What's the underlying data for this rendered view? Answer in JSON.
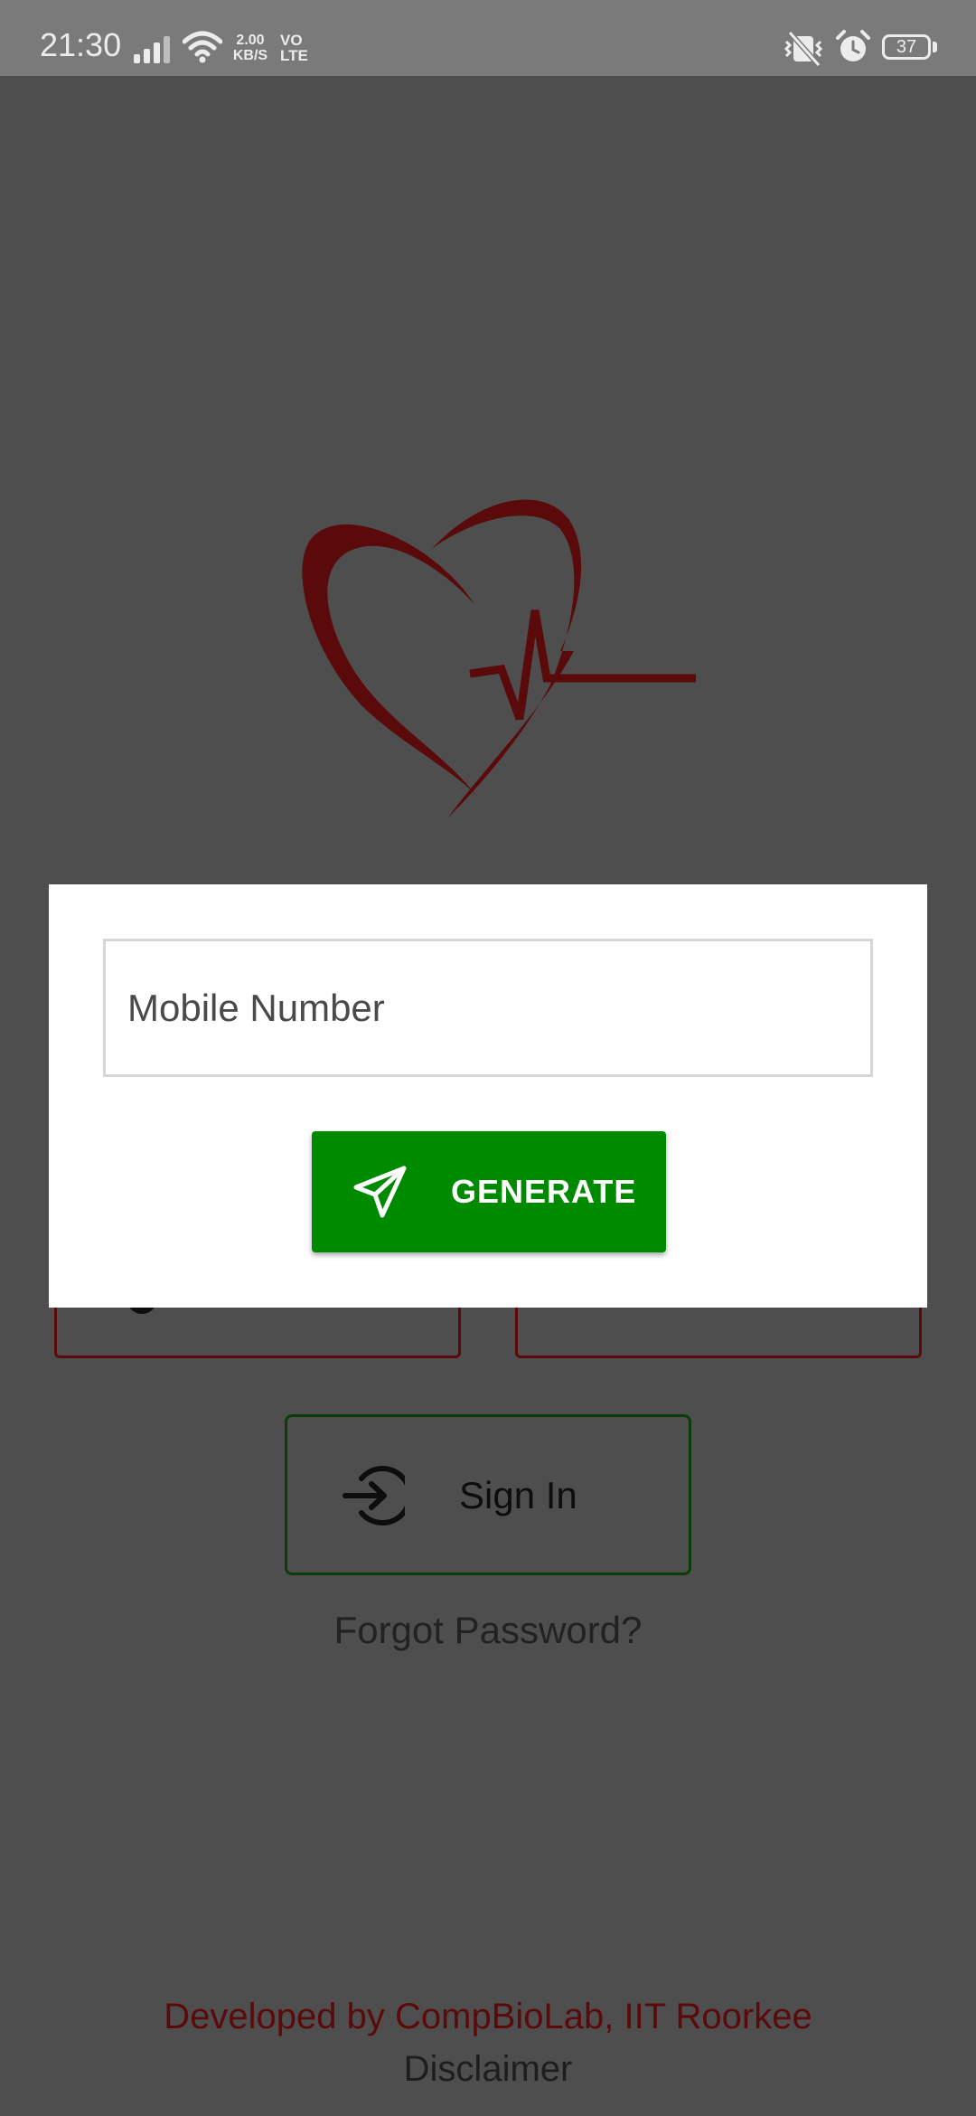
{
  "status_bar": {
    "time": "21:30",
    "net_speed_value": "2.00",
    "net_speed_unit": "KB/S",
    "net_type_top": "VO",
    "net_type_bottom": "LTE",
    "battery_level": "37",
    "icons": [
      "signal-icon",
      "wifi-icon",
      "vibrate-off-icon",
      "alarm-icon",
      "battery-icon"
    ]
  },
  "logo": {
    "icon": "heart-pulse-logo",
    "color": "#5a0a0a"
  },
  "dialog": {
    "mobile_input": {
      "placeholder": "Mobile Number",
      "value": ""
    },
    "generate_button": {
      "label": "GENERATE",
      "icon": "send-icon",
      "color": "#008a00"
    }
  },
  "signin": {
    "label": "Sign In",
    "icon": "login-icon"
  },
  "forgot_password": "Forgot Password?",
  "footer": {
    "developed_by": "Developed by CompBioLab, IIT Roorkee",
    "disclaimer": "Disclaimer"
  }
}
